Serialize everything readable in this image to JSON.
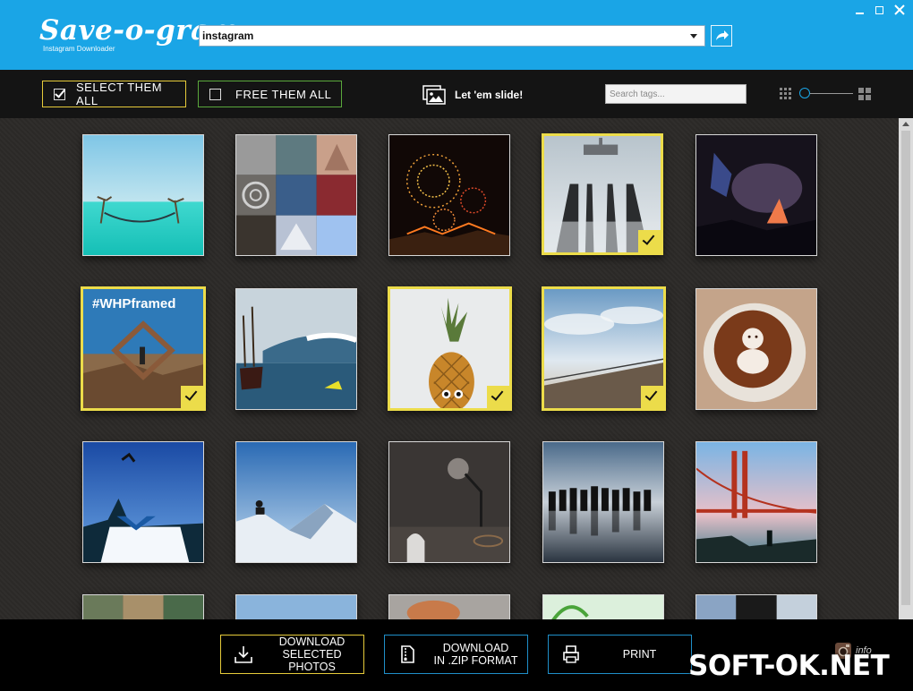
{
  "header": {
    "logo_title": "Save-o-gram",
    "logo_subtitle": "Instagram Downloader",
    "account_value": "instagram",
    "window_controls": [
      "minimize-icon",
      "maximize-icon",
      "close-icon"
    ]
  },
  "toolbar": {
    "select_all_label": "SELECT THEM ALL",
    "free_all_label": "FREE THEM ALL",
    "slide_label": "Let 'em slide!",
    "search_placeholder": "Search tags...",
    "zoom_level": 0.0
  },
  "photos": [
    {
      "id": 1,
      "subject": "hammock-sea",
      "selected": false
    },
    {
      "id": 2,
      "subject": "collage",
      "selected": false
    },
    {
      "id": 3,
      "subject": "fireworks",
      "selected": false
    },
    {
      "id": 4,
      "subject": "pier-fog",
      "selected": true
    },
    {
      "id": 5,
      "subject": "night-crowd",
      "selected": false
    },
    {
      "id": 6,
      "subject": "frame-beach",
      "selected": true,
      "caption": "#WHPframed"
    },
    {
      "id": 7,
      "subject": "wave-boat",
      "selected": false
    },
    {
      "id": 8,
      "subject": "pineapple",
      "selected": true
    },
    {
      "id": 9,
      "subject": "cloud-shore",
      "selected": true
    },
    {
      "id": 10,
      "subject": "latte-art",
      "selected": false
    },
    {
      "id": 11,
      "subject": "snowboard-jump",
      "selected": false
    },
    {
      "id": 12,
      "subject": "snowy-peak",
      "selected": false
    },
    {
      "id": 13,
      "subject": "desk-lamp",
      "selected": false
    },
    {
      "id": 14,
      "subject": "silhouettes",
      "selected": false
    },
    {
      "id": 15,
      "subject": "golden-gate",
      "selected": false
    },
    {
      "id": 16,
      "subject": "partial-collage",
      "selected": false
    },
    {
      "id": 17,
      "subject": "partial-sky",
      "selected": false
    },
    {
      "id": 18,
      "subject": "partial-dog",
      "selected": false
    },
    {
      "id": 19,
      "subject": "partial-green",
      "selected": false
    },
    {
      "id": 20,
      "subject": "partial-collage-2",
      "selected": false
    }
  ],
  "footer": {
    "download_selected_line1": "DOWNLOAD",
    "download_selected_line2": "SELECTED PHOTOS",
    "download_zip_line1": "DOWNLOAD",
    "download_zip_line2": "IN .ZIP FORMAT",
    "print_label": "PRINT",
    "info_label": "info",
    "watermark": "SOFT-OK.NET"
  },
  "colors": {
    "header_blue": "#1aa5e6",
    "select_accent": "#e6cb3a",
    "free_accent": "#5aa83c",
    "selection_yellow": "#ecdc4a"
  }
}
